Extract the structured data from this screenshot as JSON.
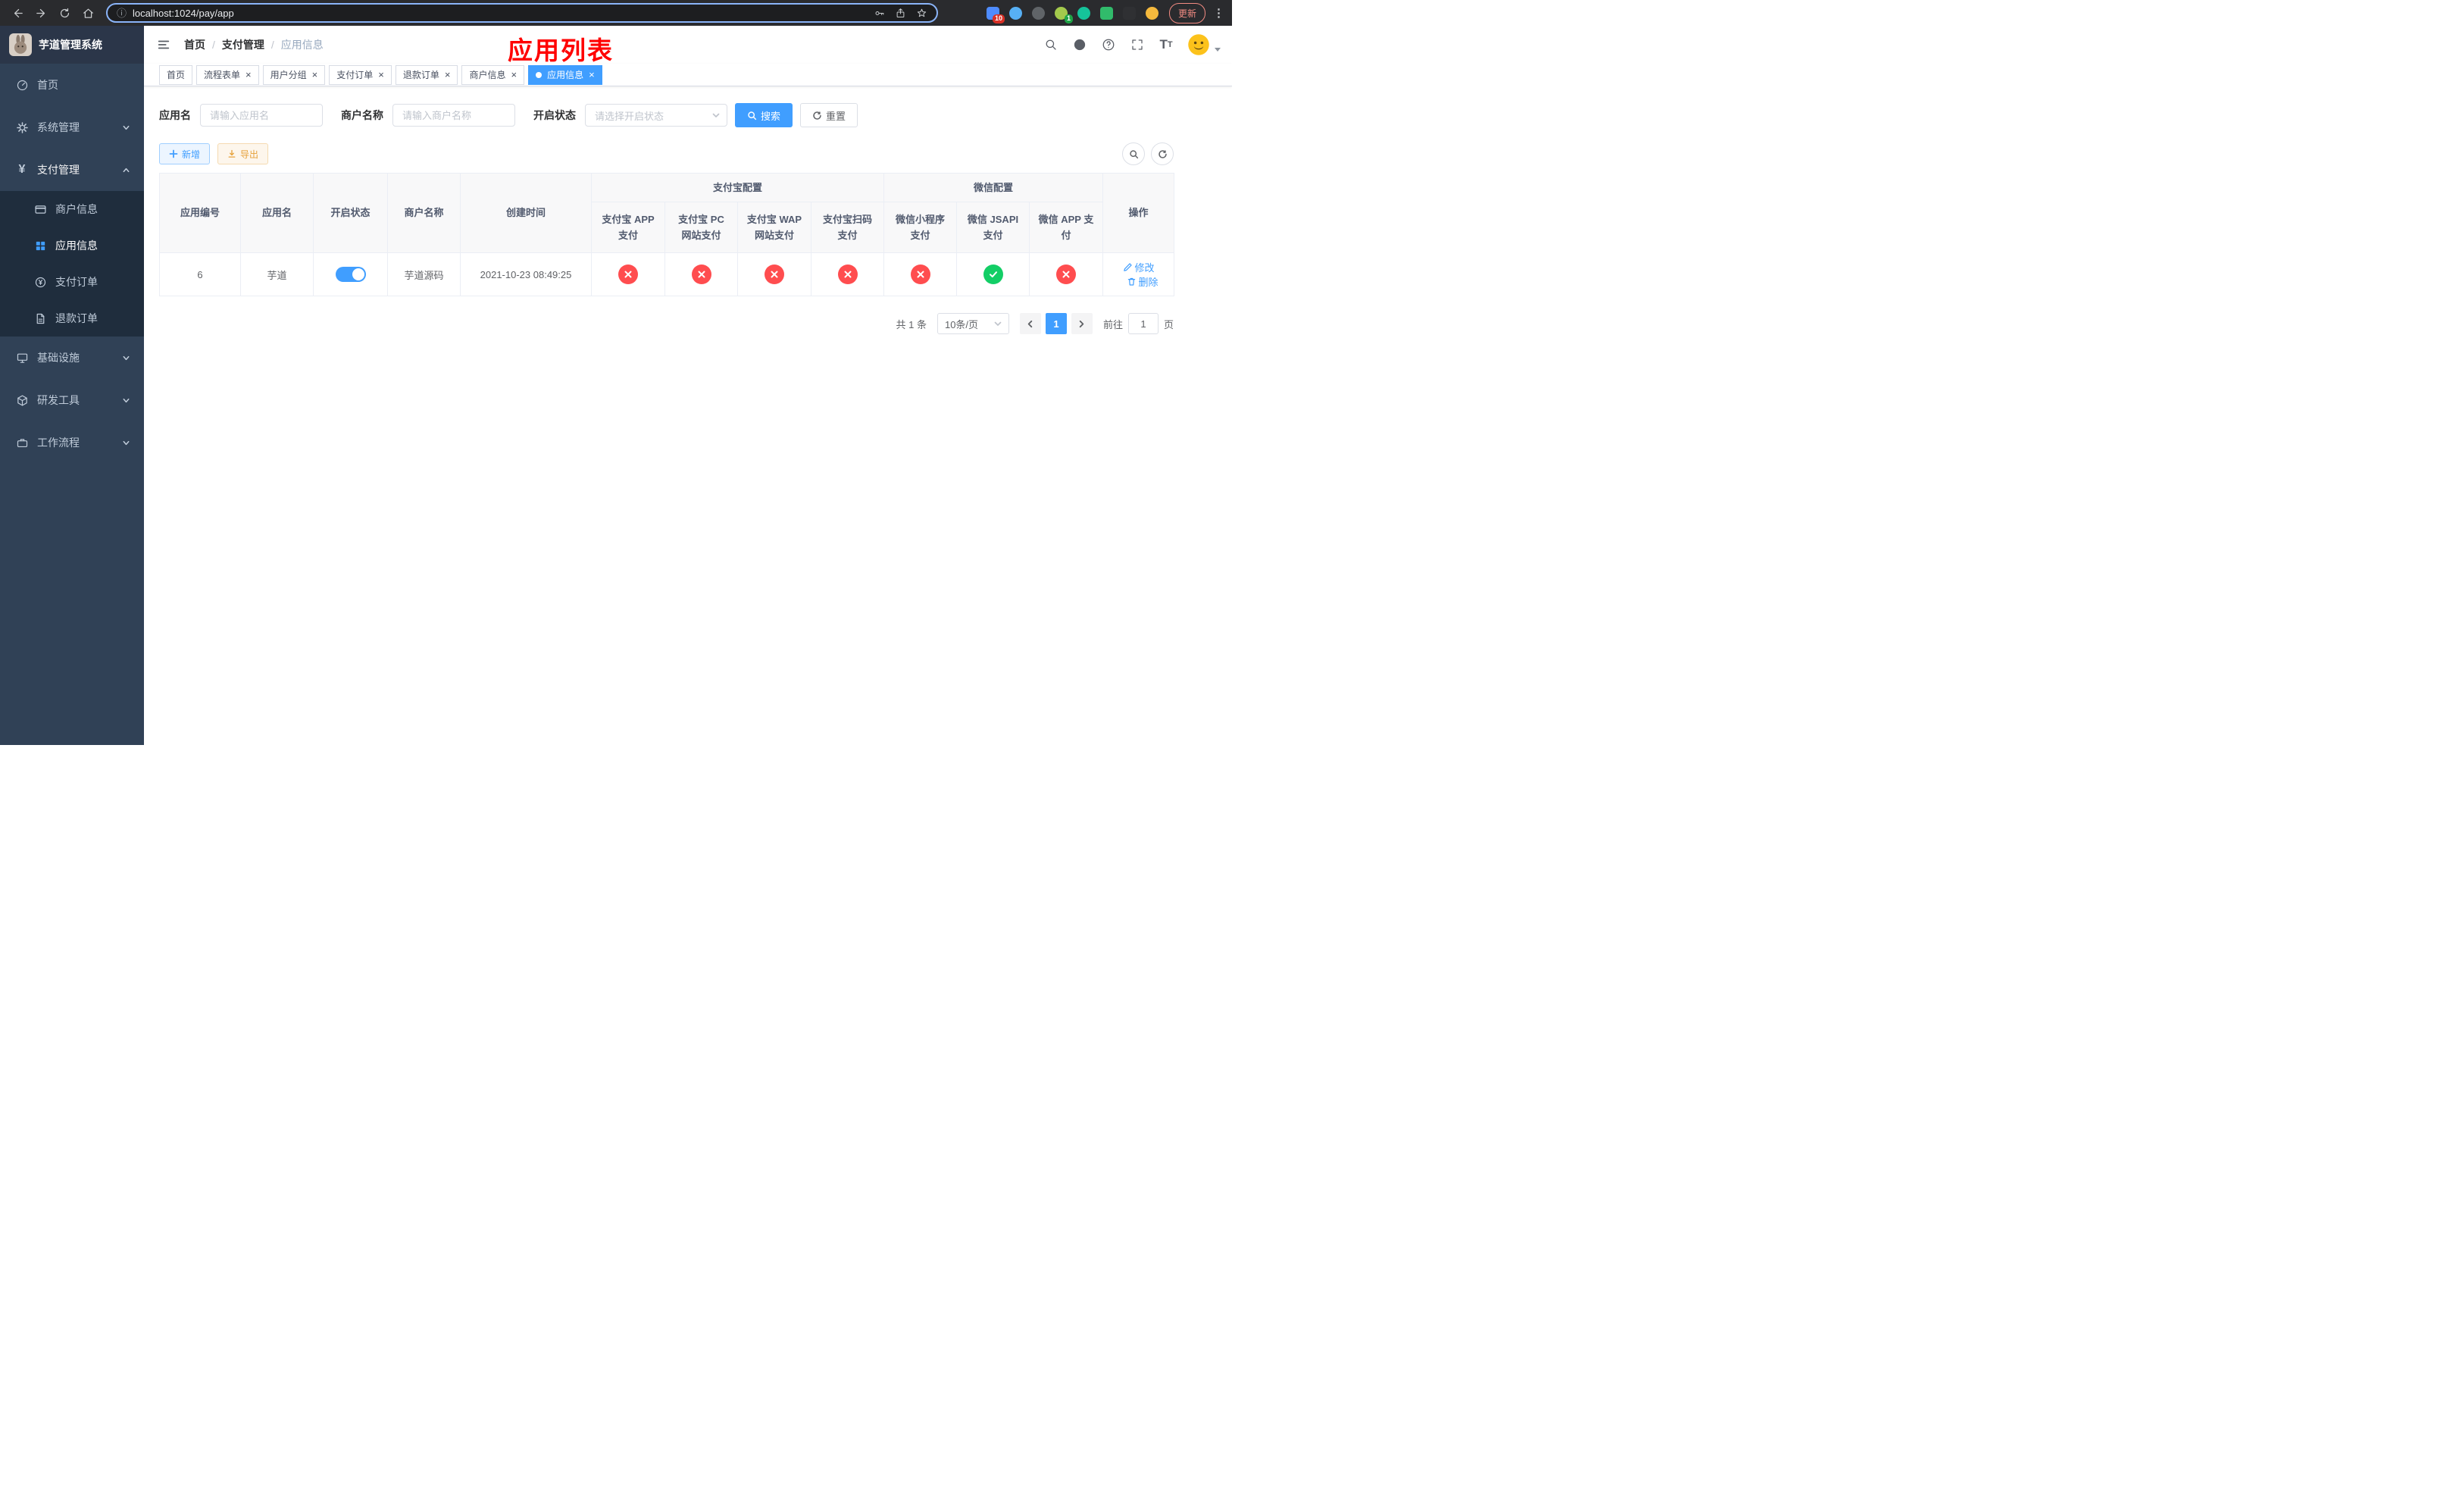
{
  "browser": {
    "url": "localhost:1024/pay/app",
    "update_button": "更新",
    "ext_badge_first": "10",
    "ext_badge_avatar": "1"
  },
  "sidebar": {
    "title": "芋道管理系统",
    "items": [
      {
        "label": "首页"
      },
      {
        "label": "系统管理"
      },
      {
        "label": "支付管理"
      },
      {
        "label": "基础设施"
      },
      {
        "label": "研发工具"
      },
      {
        "label": "工作流程"
      }
    ],
    "pay_children": [
      {
        "label": "商户信息"
      },
      {
        "label": "应用信息"
      },
      {
        "label": "支付订单"
      },
      {
        "label": "退款订单"
      }
    ]
  },
  "header": {
    "breadcrumb": [
      "首页",
      "支付管理",
      "应用信息"
    ],
    "overlay_title": "应用列表"
  },
  "tabs": [
    {
      "label": "首页",
      "closable": false,
      "active": false
    },
    {
      "label": "流程表单",
      "closable": true,
      "active": false
    },
    {
      "label": "用户分组",
      "closable": true,
      "active": false
    },
    {
      "label": "支付订单",
      "closable": true,
      "active": false
    },
    {
      "label": "退款订单",
      "closable": true,
      "active": false
    },
    {
      "label": "商户信息",
      "closable": true,
      "active": false
    },
    {
      "label": "应用信息",
      "closable": true,
      "active": true
    }
  ],
  "filters": {
    "app_name_label": "应用名",
    "app_name_placeholder": "请输入应用名",
    "merchant_label": "商户名称",
    "merchant_placeholder": "请输入商户名称",
    "status_label": "开启状态",
    "status_placeholder": "请选择开启状态",
    "search_label": "搜索",
    "reset_label": "重置"
  },
  "toolbar": {
    "add_label": "新增",
    "export_label": "导出"
  },
  "table": {
    "group_headers": {
      "alipay": "支付宝配置",
      "wechat": "微信配置"
    },
    "columns": [
      "应用编号",
      "应用名",
      "开启状态",
      "商户名称",
      "创建时间",
      "支付宝 APP 支付",
      "支付宝 PC 网站支付",
      "支付宝 WAP 网站支付",
      "支付宝扫码支付",
      "微信小程序支付",
      "微信 JSAPI 支付",
      "微信 APP 支付",
      "操作"
    ],
    "rows": [
      {
        "id": "6",
        "name": "芋道",
        "status_on": true,
        "merchant": "芋道源码",
        "created": "2021-10-23 08:49:25",
        "configs": [
          "no",
          "no",
          "no",
          "no",
          "no",
          "yes",
          "no"
        ],
        "edit_label": "修改",
        "delete_label": "删除"
      }
    ]
  },
  "pagination": {
    "total": "共 1 条",
    "page_size": "10条/页",
    "current_page": "1",
    "goto_label": "前往",
    "goto_value": "1",
    "page_suffix": "页"
  },
  "colors": {
    "primary": "#409eff",
    "success": "#13ce66",
    "danger": "#ff4d4f",
    "warning": "#e6a23c",
    "sidebar_bg": "#304156",
    "submenu_bg": "#1f2d3d",
    "annotation_red": "#ff0000"
  }
}
